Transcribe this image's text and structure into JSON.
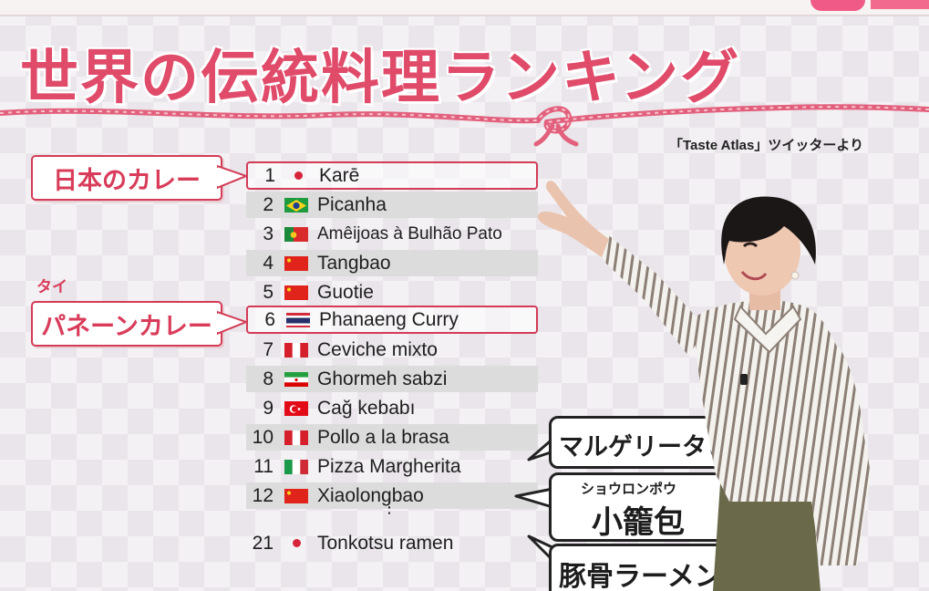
{
  "title": "世界の伝統料理ランキング",
  "source": "「Taste Atlas」ツイッターより",
  "labels": {
    "japan_curry": "日本のカレー",
    "thai_ruby": "タイ",
    "panaeng_curry": "パネーンカレー"
  },
  "ranking": [
    {
      "rank": "1",
      "name": "Karē",
      "flag": "japan"
    },
    {
      "rank": "2",
      "name": "Picanha",
      "flag": "brazil"
    },
    {
      "rank": "3",
      "name": "Amêijoas à Bulhão Pato",
      "flag": "portugal"
    },
    {
      "rank": "4",
      "name": "Tangbao",
      "flag": "china"
    },
    {
      "rank": "5",
      "name": "Guotie",
      "flag": "china"
    },
    {
      "rank": "6",
      "name": "Phanaeng Curry",
      "flag": "thailand"
    },
    {
      "rank": "7",
      "name": "Ceviche mixto",
      "flag": "peru"
    },
    {
      "rank": "8",
      "name": "Ghormeh sabzi",
      "flag": "iran"
    },
    {
      "rank": "9",
      "name": "Cağ kebabı",
      "flag": "turkey"
    },
    {
      "rank": "10",
      "name": "Pollo a la brasa",
      "flag": "peru"
    },
    {
      "rank": "11",
      "name": "Pizza Margherita",
      "flag": "italy"
    },
    {
      "rank": "12",
      "name": "Xiaolongbao",
      "flag": "china"
    },
    {
      "rank": "21",
      "name": "Tonkotsu ramen",
      "flag": "japan"
    }
  ],
  "ellipsis": "⋮",
  "bubbles": {
    "margherita": "マルゲリータピ",
    "xiaolongbao_ruby": "ショウロンポウ",
    "xiaolongbao": "小籠包",
    "tonkotsu": "豚骨ラーメン"
  },
  "colors": {
    "accent": "#d93c5a",
    "title": "#e04b6a",
    "row_shade": "#dcdcdc"
  }
}
